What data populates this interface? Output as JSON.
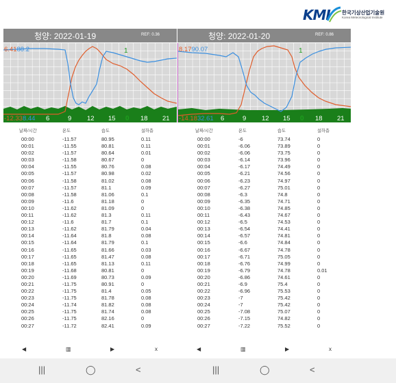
{
  "logo": {
    "mark": "KMI",
    "korean": "한국기상산업기술원",
    "english": "Korea Meteorological Institute"
  },
  "panels": [
    {
      "title": "청양: 2022-01-19",
      "ref": "REF: 0.36",
      "label_top_orange": "6.41",
      "label_top_blue": "88.2",
      "label_one": "1",
      "label_bottom_orange": "-12.33",
      "label_bottom_blue": "8.44",
      "label_zero": "0",
      "x_ticks": [
        "6",
        "9",
        "12",
        "15",
        "18",
        "21"
      ],
      "columns": [
        "날짜/시간",
        "온도",
        "습도",
        "설하층"
      ],
      "rows": [
        [
          "00:00",
          "-11.57",
          "80.95",
          "0.11"
        ],
        [
          "00:01",
          "-11.55",
          "80.81",
          "0.11"
        ],
        [
          "00:02",
          "-11.57",
          "80.64",
          "0.01"
        ],
        [
          "00:03",
          "-11.58",
          "80.67",
          "0"
        ],
        [
          "00:04",
          "-11.55",
          "80.76",
          "0.08"
        ],
        [
          "00:05",
          "-11.57",
          "80.98",
          "0.02"
        ],
        [
          "00:06",
          "-11.58",
          "81.02",
          "0.08"
        ],
        [
          "00:07",
          "-11.57",
          "81.1",
          "0.09"
        ],
        [
          "00:08",
          "-11.58",
          "81.06",
          "0.1"
        ],
        [
          "00:09",
          "-11.6",
          "81.18",
          "0"
        ],
        [
          "00:10",
          "-11.62",
          "81.09",
          "0"
        ],
        [
          "00:11",
          "-11.62",
          "81.3",
          "0.11"
        ],
        [
          "00:12",
          "-11.6",
          "81.7",
          "0.1"
        ],
        [
          "00:13",
          "-11.62",
          "81.79",
          "0.04"
        ],
        [
          "00:14",
          "-11.64",
          "81.8",
          "0.08"
        ],
        [
          "00:15",
          "-11.64",
          "81.79",
          "0.1"
        ],
        [
          "00:16",
          "-11.65",
          "81.66",
          "0.03"
        ],
        [
          "00:17",
          "-11.65",
          "81.47",
          "0.08"
        ],
        [
          "00:18",
          "-11.65",
          "81.13",
          "0.11"
        ],
        [
          "00:19",
          "-11.68",
          "80.81",
          "0"
        ],
        [
          "00:20",
          "-11.69",
          "80.73",
          "0.09"
        ],
        [
          "00:21",
          "-11.75",
          "80.91",
          "0"
        ],
        [
          "00:22",
          "-11.75",
          "81.4",
          "0.05"
        ],
        [
          "00:23",
          "-11.75",
          "81.78",
          "0.08"
        ],
        [
          "00:24",
          "-11.74",
          "81.82",
          "0.08"
        ],
        [
          "00:25",
          "-11.75",
          "81.74",
          "0.08"
        ],
        [
          "00:26",
          "-11.75",
          "82.16",
          "0"
        ],
        [
          "00:27",
          "-11.72",
          "82.41",
          "0.09"
        ]
      ]
    },
    {
      "title": "청양: 2022-01-20",
      "ref": "REF: 0.86",
      "label_top_orange": "8.17",
      "label_top_blue": "90.07",
      "label_one": "1",
      "label_bottom_orange": "-14.18",
      "label_bottom_blue": "32.61",
      "label_zero": "0",
      "x_ticks": [
        "6",
        "9",
        "12",
        "15",
        "18",
        "21"
      ],
      "columns": [
        "날짜/시간",
        "온도",
        "습도",
        "설하층"
      ],
      "rows": [
        [
          "00:00",
          "-6",
          "73.74",
          "0"
        ],
        [
          "00:01",
          "-6.06",
          "73.89",
          "0"
        ],
        [
          "00:02",
          "-6.06",
          "73.75",
          "0"
        ],
        [
          "00:03",
          "-6.14",
          "73.96",
          "0"
        ],
        [
          "00:04",
          "-6.17",
          "74.49",
          "0"
        ],
        [
          "00:05",
          "-6.21",
          "74.56",
          "0"
        ],
        [
          "00:06",
          "-6.23",
          "74.97",
          "0"
        ],
        [
          "00:07",
          "-6.27",
          "75.01",
          "0"
        ],
        [
          "00:08",
          "-6.3",
          "74.8",
          "0"
        ],
        [
          "00:09",
          "-6.35",
          "74.71",
          "0"
        ],
        [
          "00:10",
          "-6.38",
          "74.85",
          "0"
        ],
        [
          "00:11",
          "-6.43",
          "74.67",
          "0"
        ],
        [
          "00:12",
          "-6.5",
          "74.53",
          "0"
        ],
        [
          "00:13",
          "-6.54",
          "74.41",
          "0"
        ],
        [
          "00:14",
          "-6.57",
          "74.81",
          "0"
        ],
        [
          "00:15",
          "-6.6",
          "74.84",
          "0"
        ],
        [
          "00:16",
          "-6.67",
          "74.78",
          "0"
        ],
        [
          "00:17",
          "-6.71",
          "75.05",
          "0"
        ],
        [
          "00:18",
          "-6.76",
          "74.99",
          "0"
        ],
        [
          "00:19",
          "-6.79",
          "74.78",
          "0.01"
        ],
        [
          "00:20",
          "-6.86",
          "74.61",
          "0"
        ],
        [
          "00:21",
          "-6.9",
          "75.4",
          "0"
        ],
        [
          "00:22",
          "-6.96",
          "75.53",
          "0"
        ],
        [
          "00:23",
          "-7",
          "75.42",
          "0"
        ],
        [
          "00:24",
          "-7",
          "75.42",
          "0"
        ],
        [
          "00:25",
          "-7.08",
          "75.07",
          "0"
        ],
        [
          "00:26",
          "-7.15",
          "74.82",
          "0"
        ],
        [
          "00:27",
          "-7.22",
          "75.52",
          "0"
        ]
      ]
    }
  ],
  "toolbar": {
    "prev_icon": "◀",
    "menu_icon": "▥",
    "next_icon": "▶",
    "close_label": "x"
  },
  "navbar": {
    "recents_icon": "|||",
    "home_icon": "◯",
    "back_icon": "<"
  },
  "colors": {
    "temperature": "#e05c2a",
    "humidity": "#3a8fe0",
    "snow": "#1a7f1a",
    "header_bg": "#888888",
    "chart_bg": "#d8d8d8"
  }
}
